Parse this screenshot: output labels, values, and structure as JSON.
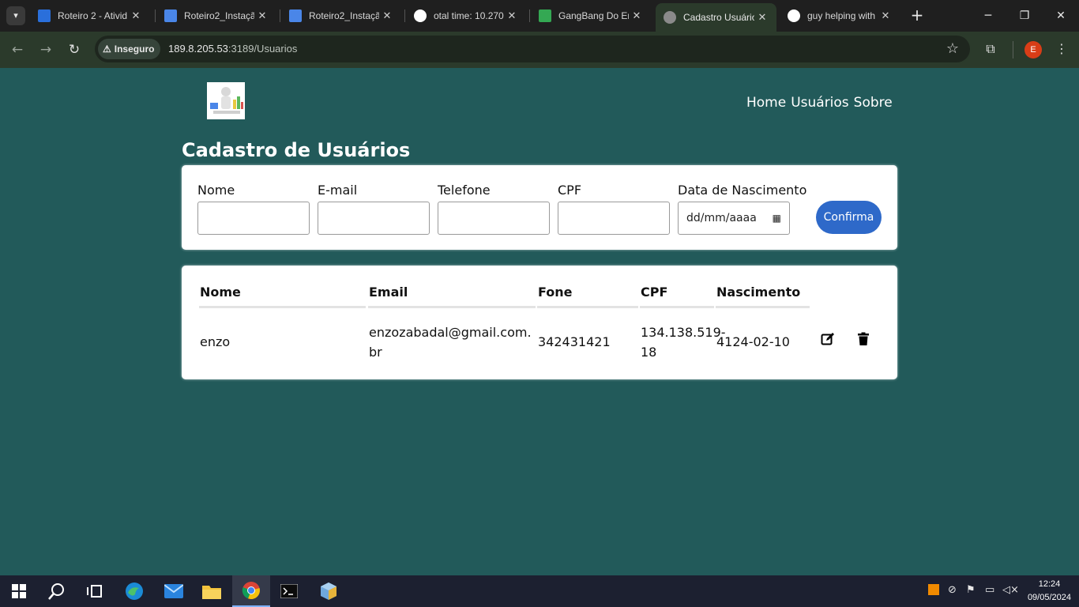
{
  "browser": {
    "tabs": [
      {
        "title": "Roteiro 2 - Ativid",
        "icon": "google-classroom-icon",
        "color": "#2a6fdb"
      },
      {
        "title": "Roteiro2_Instaçã",
        "icon": "google-docs-icon",
        "color": "#4a86e8"
      },
      {
        "title": "Roteiro2_Instaçã",
        "icon": "google-docs-icon",
        "color": "#4a86e8"
      },
      {
        "title": "otal time: 10.270",
        "icon": "google-icon",
        "color": "#ffffff"
      },
      {
        "title": "GangBang Do En",
        "icon": "google-chat-icon",
        "color": "#34a853"
      },
      {
        "title": "Cadastro Usuário",
        "icon": "globe-icon",
        "color": "#8a8a8a"
      },
      {
        "title": "guy helping with",
        "icon": "google-icon",
        "color": "#ffffff"
      }
    ],
    "security_label": "Inseguro",
    "url_host": "189.8.205.53",
    "url_path": ":3189/Usuarios",
    "profile_initial": "E"
  },
  "page": {
    "nav": [
      "Home",
      "Usuários",
      "Sobre"
    ],
    "heading": "Cadastro de Usuários",
    "form": {
      "name_label": "Nome",
      "email_label": "E-mail",
      "phone_label": "Telefone",
      "cpf_label": "CPF",
      "birth_label": "Data de Nascimento",
      "birth_placeholder": "dd/mm/aaaa",
      "confirm_label": "Confirma"
    },
    "table": {
      "headers": [
        "Nome",
        "Email",
        "Fone",
        "CPF",
        "Nascimento"
      ],
      "rows": [
        {
          "nome": "enzo",
          "email_line1": "enzozabadal@gmail.com.",
          "email_line2": "br",
          "fone": "342431421",
          "cpf_line1": "134.138.519-",
          "cpf_line2": "18",
          "nascimento": "4124-02-10"
        }
      ]
    }
  },
  "taskbar": {
    "time": "12:24",
    "date": "09/05/2024"
  },
  "colors": {
    "page_background": "#225a5a",
    "accent_button": "#2e69c9"
  }
}
